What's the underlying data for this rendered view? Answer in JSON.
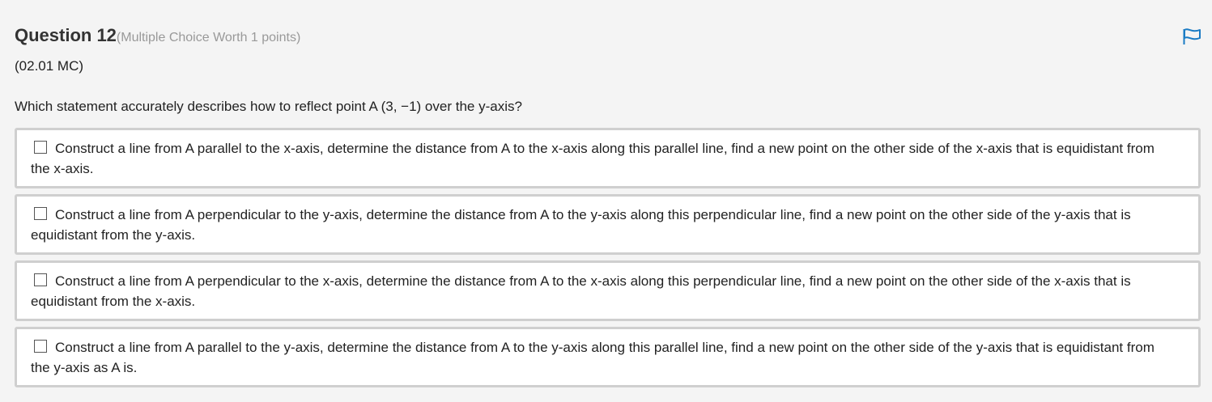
{
  "question": {
    "title": "Question 12",
    "worth": "(Multiple Choice Worth 1 points)",
    "code": "(02.01 MC)",
    "prompt": "Which statement accurately describes how to reflect point A (3, −1) over the y-axis?"
  },
  "flag_icon": "flag-icon",
  "colors": {
    "flag": "#1a7bc4",
    "background": "#f4f4f4",
    "choice_border": "#cfcfcf"
  },
  "choices": [
    {
      "label": "Construct a line from A parallel to the x-axis, determine the distance from A to the x-axis along this parallel line, find a new point on the other side of the x-axis that is equidistant from the x-axis."
    },
    {
      "label": "Construct a line from A perpendicular to the y-axis, determine the distance from A to the y-axis along this perpendicular line, find a new point on the other side of the y-axis that is equidistant from the y-axis."
    },
    {
      "label": "Construct a line from A perpendicular to the x-axis, determine the distance from A to the x-axis along this perpendicular line, find a new point on the other side of the x-axis that is equidistant from the x-axis."
    },
    {
      "label": "Construct a line from A parallel to the y-axis, determine the distance from A to the y-axis along this parallel line, find a new point on the other side of the y-axis that is equidistant from the y-axis as A is."
    }
  ]
}
